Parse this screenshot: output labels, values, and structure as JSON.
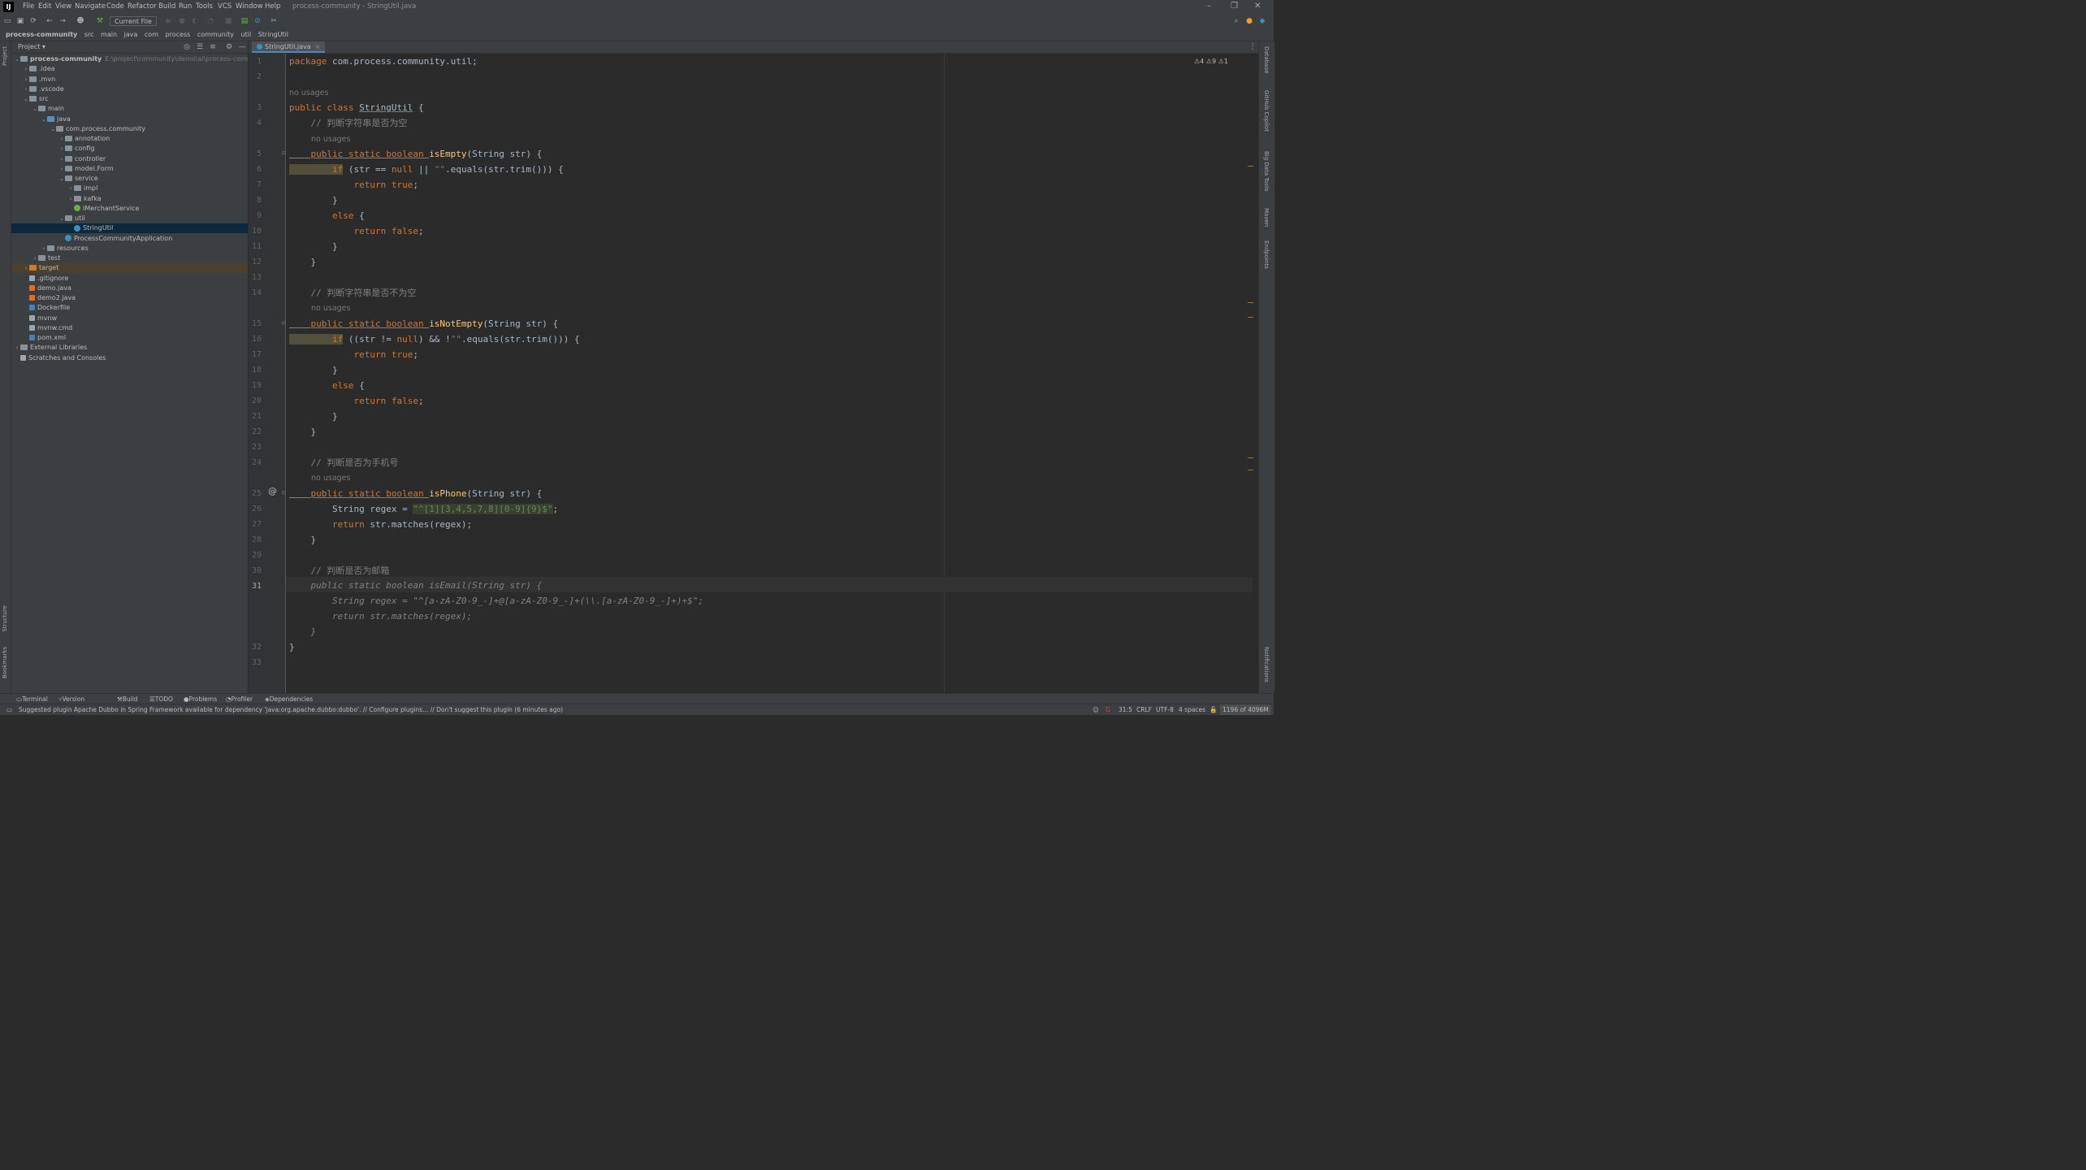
{
  "app": {
    "logo": "IJ",
    "title": "process-community - StringUtil.java",
    "menu": [
      "File",
      "Edit",
      "View",
      "Navigate",
      "Code",
      "Refactor",
      "Build",
      "Run",
      "Tools",
      "VCS",
      "Window",
      "Help"
    ],
    "window_buttons": [
      "–",
      "❐",
      "✕"
    ]
  },
  "toolbar": {
    "run_config": "Current File ▾"
  },
  "breadcrumb": [
    "process-community",
    "src",
    "main",
    "java",
    "com",
    "process",
    "community",
    "util",
    "StringUtil"
  ],
  "left_stripe": {
    "project": "Project",
    "structure": "Structure",
    "bookmarks": "Bookmarks"
  },
  "right_stripe": {
    "database": "Database",
    "copilot": "GitHub Copilot",
    "bigdata": "Big Data Tools",
    "maven": "Maven",
    "endpoints": "Endpoints",
    "notifications": "Notifications"
  },
  "project_panel": {
    "title": "Project ▾",
    "tree": [
      {
        "label": "process-community",
        "sub": "E:\\project\\community\\demo\\ai\\process-community",
        "depth": 0,
        "arrow": "v",
        "icon": "fold",
        "bold": true
      },
      {
        "label": ".idea",
        "depth": 1,
        "arrow": ">",
        "icon": "fold"
      },
      {
        "label": ".mvn",
        "depth": 1,
        "arrow": ">",
        "icon": "fold"
      },
      {
        "label": ".vscode",
        "depth": 1,
        "arrow": ">",
        "icon": "fold"
      },
      {
        "label": "src",
        "depth": 1,
        "arrow": "v",
        "icon": "fold"
      },
      {
        "label": "main",
        "depth": 2,
        "arrow": "v",
        "icon": "fold"
      },
      {
        "label": "java",
        "depth": 3,
        "arrow": "v",
        "icon": "fold-src"
      },
      {
        "label": "com.process.community",
        "depth": 4,
        "arrow": "v",
        "icon": "fold-pkg"
      },
      {
        "label": "annotation",
        "depth": 5,
        "arrow": ">",
        "icon": "fold-pkg"
      },
      {
        "label": "config",
        "depth": 5,
        "arrow": ">",
        "icon": "fold-pkg"
      },
      {
        "label": "controller",
        "depth": 5,
        "arrow": ">",
        "icon": "fold-pkg"
      },
      {
        "label": "model.Form",
        "depth": 5,
        "arrow": ">",
        "icon": "fold-pkg"
      },
      {
        "label": "service",
        "depth": 5,
        "arrow": "v",
        "icon": "fold-pkg"
      },
      {
        "label": "impl",
        "depth": 6,
        "arrow": ">",
        "icon": "fold-pkg"
      },
      {
        "label": "kafka",
        "depth": 6,
        "arrow": ">",
        "icon": "fold-pkg"
      },
      {
        "label": "IMerchantService",
        "depth": 6,
        "arrow": "",
        "icon": "iface-ic"
      },
      {
        "label": "util",
        "depth": 5,
        "arrow": "v",
        "icon": "fold-pkg"
      },
      {
        "label": "StringUtil",
        "depth": 6,
        "arrow": "",
        "icon": "class-ic",
        "selected": true
      },
      {
        "label": "ProcessCommunityApplication",
        "depth": 5,
        "arrow": "",
        "icon": "class-ic"
      },
      {
        "label": "resources",
        "depth": 3,
        "arrow": ">",
        "icon": "fold"
      },
      {
        "label": "test",
        "depth": 2,
        "arrow": ">",
        "icon": "fold"
      },
      {
        "label": "target",
        "depth": 1,
        "arrow": ">",
        "icon": "fold-orange",
        "excluded": true
      },
      {
        "label": ".gitignore",
        "depth": 1,
        "arrow": "",
        "icon": "file-ic"
      },
      {
        "label": "demo.java",
        "depth": 1,
        "arrow": "",
        "icon": "java-ic"
      },
      {
        "label": "demo2.java",
        "depth": 1,
        "arrow": "",
        "icon": "java-ic"
      },
      {
        "label": "Dockerfile",
        "depth": 1,
        "arrow": "",
        "icon": "xml-ic"
      },
      {
        "label": "mvnw",
        "depth": 1,
        "arrow": "",
        "icon": "file-ic"
      },
      {
        "label": "mvnw.cmd",
        "depth": 1,
        "arrow": "",
        "icon": "file-ic"
      },
      {
        "label": "pom.xml",
        "depth": 1,
        "arrow": "",
        "icon": "xml-ic"
      },
      {
        "label": "External Libraries",
        "depth": 0,
        "arrow": ">",
        "icon": "fold"
      },
      {
        "label": "Scratches and Consoles",
        "depth": 0,
        "arrow": "",
        "icon": "file-ic"
      }
    ]
  },
  "editor": {
    "tab": "StringUtil.java",
    "inspections": "⚠4 ⚠9 ⚠1",
    "hint": "no usages",
    "gutter_at": "@",
    "lines": {
      "l1a": "package ",
      "l1b": "com.process.community.util;",
      "l3a": "public class ",
      "l3b": "StringUtil",
      "l3c": " {",
      "l4": "    // 判断字符串是否为空",
      "l5a": "    public static boolean ",
      "l5b": "isEmpty",
      "l5c": "(String str) {",
      "l6a": "        if",
      "l6b": " (str == ",
      "l6c": "null",
      "l6d": " || ",
      "l6e": "\"\"",
      "l6f": ".equals(str.trim())) {",
      "l7a": "            return ",
      "l7b": "true",
      "l7c": ";",
      "l8": "        }",
      "l9a": "        else",
      "l9b": " {",
      "l10a": "            return ",
      "l10b": "false",
      "l10c": ";",
      "l11": "        }",
      "l12": "    }",
      "l14": "    // 判断字符串是否不为空",
      "l15a": "    public static boolean ",
      "l15b": "isNotEmpty",
      "l15c": "(String str) {",
      "l16a": "        if",
      "l16b": " ((str != ",
      "l16c": "null",
      "l16d": ") && !",
      "l16e": "\"\"",
      "l16f": ".equals(str.trim())) {",
      "l17a": "            return ",
      "l17b": "true",
      "l17c": ";",
      "l18": "        }",
      "l19a": "        else",
      "l19b": " {",
      "l20a": "            return ",
      "l20b": "false",
      "l20c": ";",
      "l21": "        }",
      "l22": "    }",
      "l24": "    // 判断是否为手机号",
      "l25a": "    public static boolean ",
      "l25b": "isPhone",
      "l25c": "(String str) {",
      "l26a": "        String regex = ",
      "l26b": "\"^[1][3,4,5,7,8][0-9]{9}$\"",
      "l26c": ";",
      "l27a": "        return ",
      "l27b": "str.matches(regex);",
      "l28": "    }",
      "l30": "    // 判断是否为邮箱",
      "l31": "    public static boolean isEmail(String str) {",
      "l31b": "        String regex = \"^[a-zA-Z0-9_-]+@[a-zA-Z0-9_-]+(\\\\.[a-zA-Z0-9_-]+)+$\";",
      "l31c": "        return str.matches(regex);",
      "l31d": "    }",
      "l32": "}"
    }
  },
  "bottom_tools": [
    "Terminal",
    "Version Control",
    "Build",
    "TODO",
    "Problems",
    "Profiler",
    "Dependencies"
  ],
  "status": {
    "message": "Suggested plugin Apache Dubbo in Spring Framework available for dependency 'java:org.apache.dubbo:dubbo'. // Configure plugins... // Don't suggest this plugin (6 minutes ago)",
    "position": "31:5",
    "line_sep": "CRLF",
    "encoding": "UTF-8",
    "indent": "4 spaces",
    "memory": "1196 of 4096M"
  }
}
